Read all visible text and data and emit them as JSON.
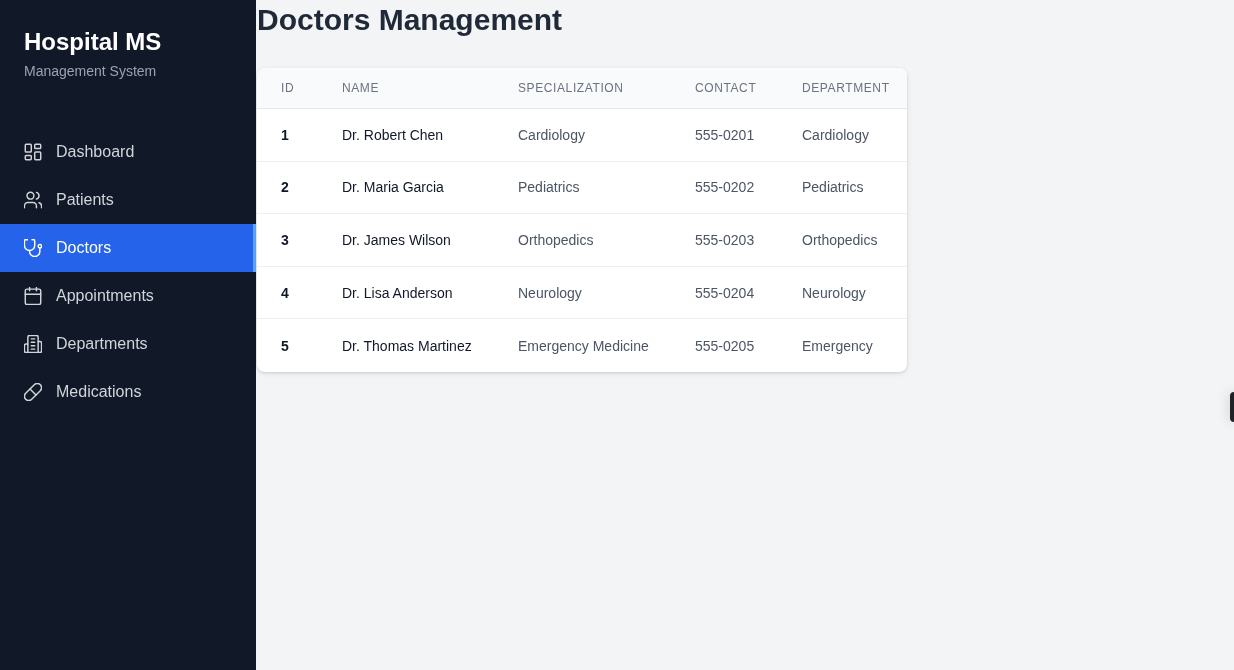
{
  "sidebar": {
    "title": "Hospital MS",
    "subtitle": "Management System",
    "items": [
      {
        "label": "Dashboard",
        "kind": "dashboard",
        "selected": false
      },
      {
        "label": "Patients",
        "kind": "users",
        "selected": false
      },
      {
        "label": "Doctors",
        "kind": "stethoscope",
        "selected": true
      },
      {
        "label": "Appointments",
        "kind": "calendar",
        "selected": false
      },
      {
        "label": "Departments",
        "kind": "building",
        "selected": false
      },
      {
        "label": "Medications",
        "kind": "pill",
        "selected": false
      }
    ]
  },
  "page": {
    "title": "Doctors Management"
  },
  "table": {
    "columns": [
      "ID",
      "NAME",
      "SPECIALIZATION",
      "CONTACT",
      "DEPARTMENT"
    ],
    "rows": [
      [
        "1",
        "Dr. Robert Chen",
        "Cardiology",
        "555-0201",
        "Cardiology"
      ],
      [
        "2",
        "Dr. Maria Garcia",
        "Pediatrics",
        "555-0202",
        "Pediatrics"
      ],
      [
        "3",
        "Dr. James Wilson",
        "Orthopedics",
        "555-0203",
        "Orthopedics"
      ],
      [
        "4",
        "Dr. Lisa Anderson",
        "Neurology",
        "555-0204",
        "Neurology"
      ],
      [
        "5",
        "Dr. Thomas Martinez",
        "Emergency Medicine",
        "555-0205",
        "Emergency"
      ]
    ]
  }
}
